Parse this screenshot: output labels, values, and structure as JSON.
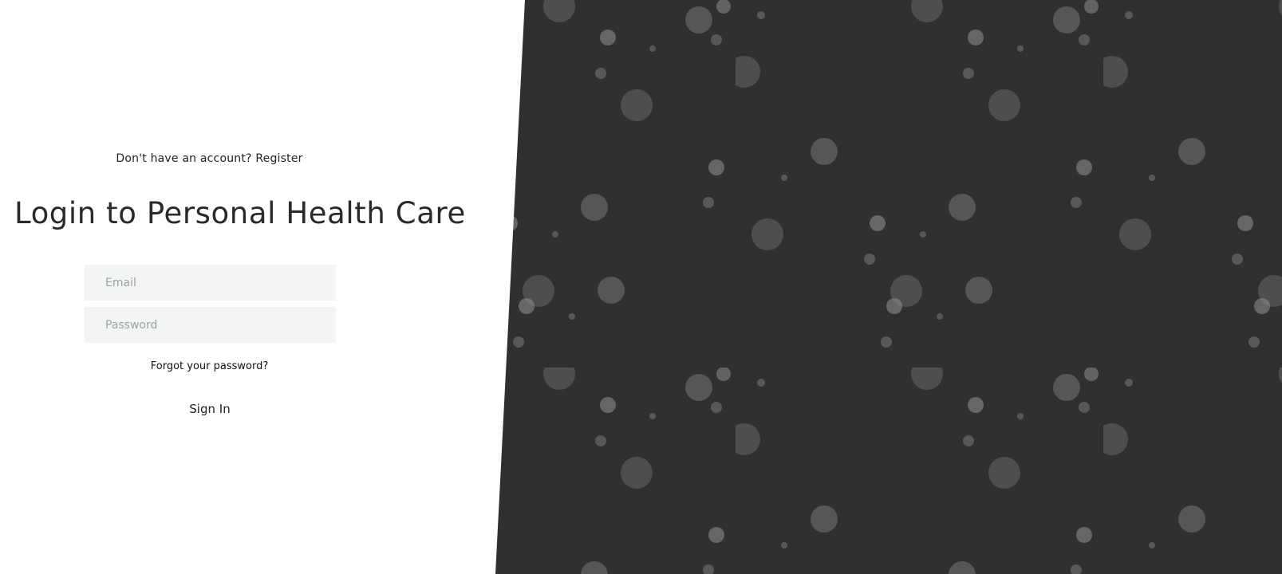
{
  "auth": {
    "register_prompt": "Don't have an account?",
    "register_link": "Register",
    "title": "Login to Personal Health Care",
    "email_placeholder": "Email",
    "password_placeholder": "Password",
    "forgot_password": "Forgot your password?",
    "sign_in": "Sign In"
  },
  "theme": {
    "panel_color": "#303030",
    "bubble_color": "#8a8a8a",
    "field_background": "#f2f5f4"
  }
}
